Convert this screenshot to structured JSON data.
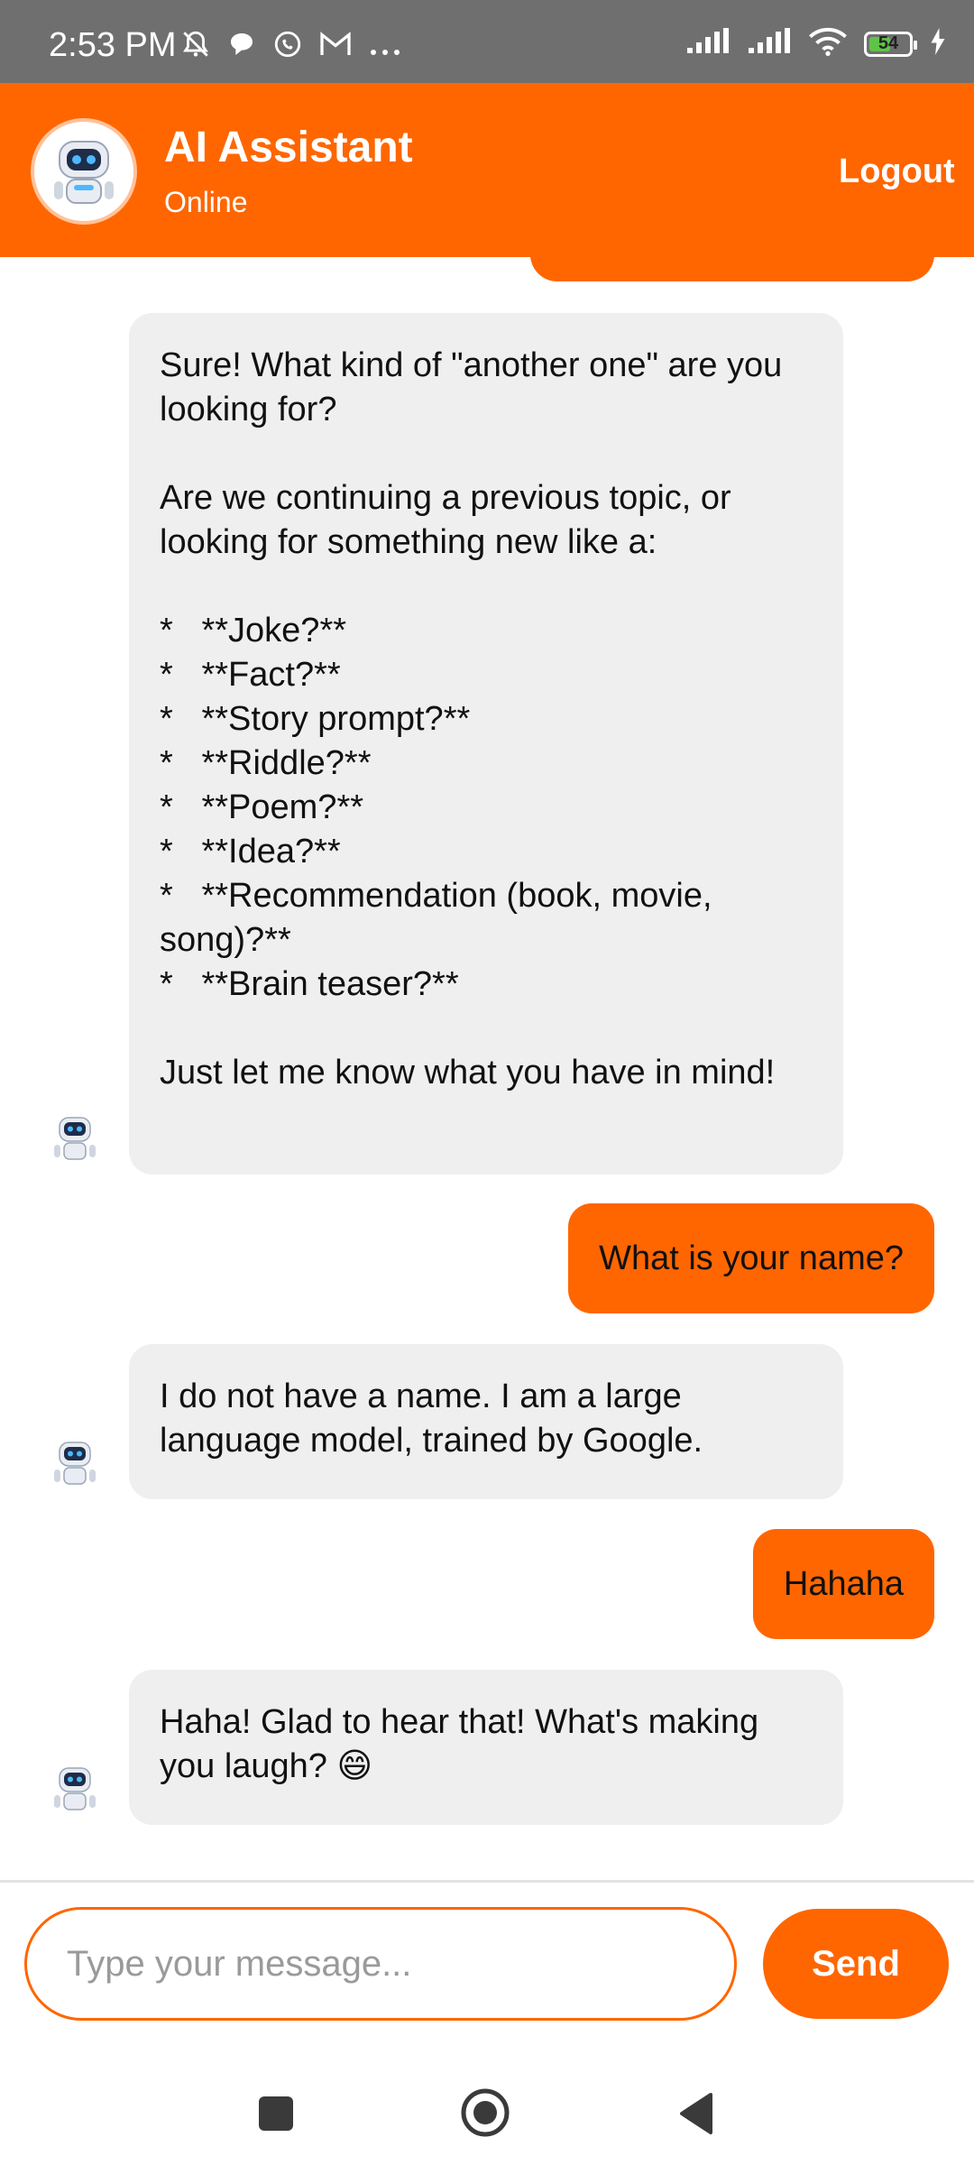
{
  "status_bar": {
    "time": "2:53 PM",
    "battery_level": 54,
    "icons": [
      "bell-muted-icon",
      "chat-bubble-icon",
      "whatsapp-icon",
      "gmail-icon",
      "more-dots-icon",
      "signal-icon",
      "signal-icon",
      "wifi-icon",
      "battery-icon",
      "charging-icon"
    ]
  },
  "header": {
    "title": "AI Assistant",
    "status": "Online",
    "logout_label": "Logout"
  },
  "messages": [
    {
      "sender": "bot",
      "text": "Sure! What kind of \"another one\" are you looking for?\n\nAre we continuing a previous topic, or looking for something new like a:\n\n*   **Joke?**\n*   **Fact?**\n*   **Story prompt?**\n*   **Riddle?**\n*   **Poem?**\n*   **Idea?**\n*   **Recommendation (book, movie, song)?**\n*   **Brain teaser?**\n\nJust let me know what you have in mind!"
    },
    {
      "sender": "user",
      "text": "What is your name?"
    },
    {
      "sender": "bot",
      "text": "I do not have a name. I am a large language model, trained by Google."
    },
    {
      "sender": "user",
      "text": "Hahaha"
    },
    {
      "sender": "bot",
      "text": "Haha! Glad to hear that! What's making you laugh? 😄"
    }
  ],
  "composer": {
    "placeholder": "Type your message...",
    "send_label": "Send"
  },
  "colors": {
    "accent": "#ff6600",
    "bot_bubble": "#efefef",
    "status_bar": "#6f6f6f"
  }
}
